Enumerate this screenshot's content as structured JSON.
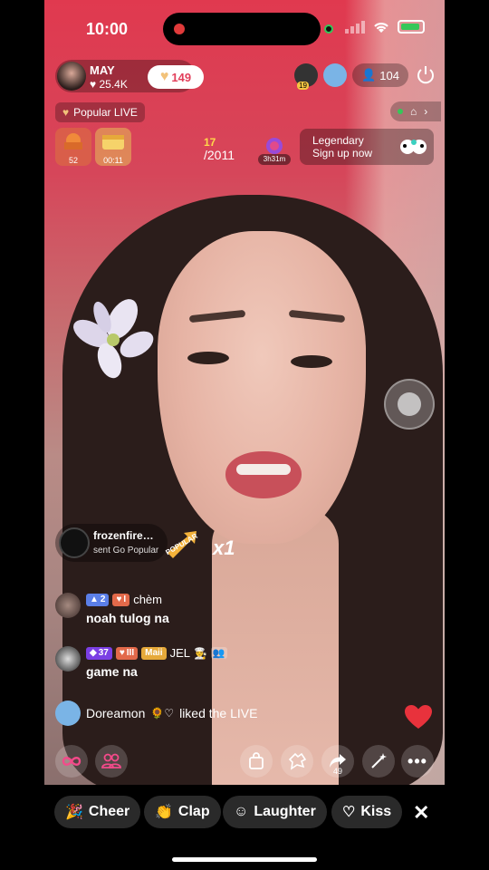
{
  "status_bar": {
    "time": "10:00"
  },
  "host": {
    "name": "MAY",
    "likes": "25.4K",
    "follow_count": "149"
  },
  "viewers": {
    "count": "104",
    "badge_level": "19"
  },
  "popular_tag": "Popular LIVE",
  "gifts": [
    {
      "label": "52"
    },
    {
      "label": "00:11"
    }
  ],
  "rank": {
    "position": "17",
    "total": "/2011"
  },
  "timer": "3h31m",
  "legendary": {
    "title": "Legendary",
    "subtitle": "Sign up now"
  },
  "gift_notification": {
    "user": "frozenfire…",
    "text": "sent Go Popular",
    "count": "x1",
    "gift_label": "POPULAR"
  },
  "chat": [
    {
      "level": "2",
      "fan_level": "I",
      "user": "chèm",
      "message": "noah tulog na"
    },
    {
      "level": "37",
      "fan_level": "III",
      "badge": "Maii",
      "user": "JEL",
      "message": "game na"
    }
  ],
  "liked": {
    "user": "Doreamon",
    "suffix": "liked the LIVE"
  },
  "bottom": {
    "share_count": "49"
  },
  "reactions": [
    {
      "label": "Cheer"
    },
    {
      "label": "Clap"
    },
    {
      "label": "Laughter"
    },
    {
      "label": "Kiss"
    }
  ],
  "colors": {
    "accent": "#e23f5b",
    "gold": "#ffd84a",
    "purple_badge": "#7b3fe4",
    "level_blue": "#5b7fe8"
  }
}
